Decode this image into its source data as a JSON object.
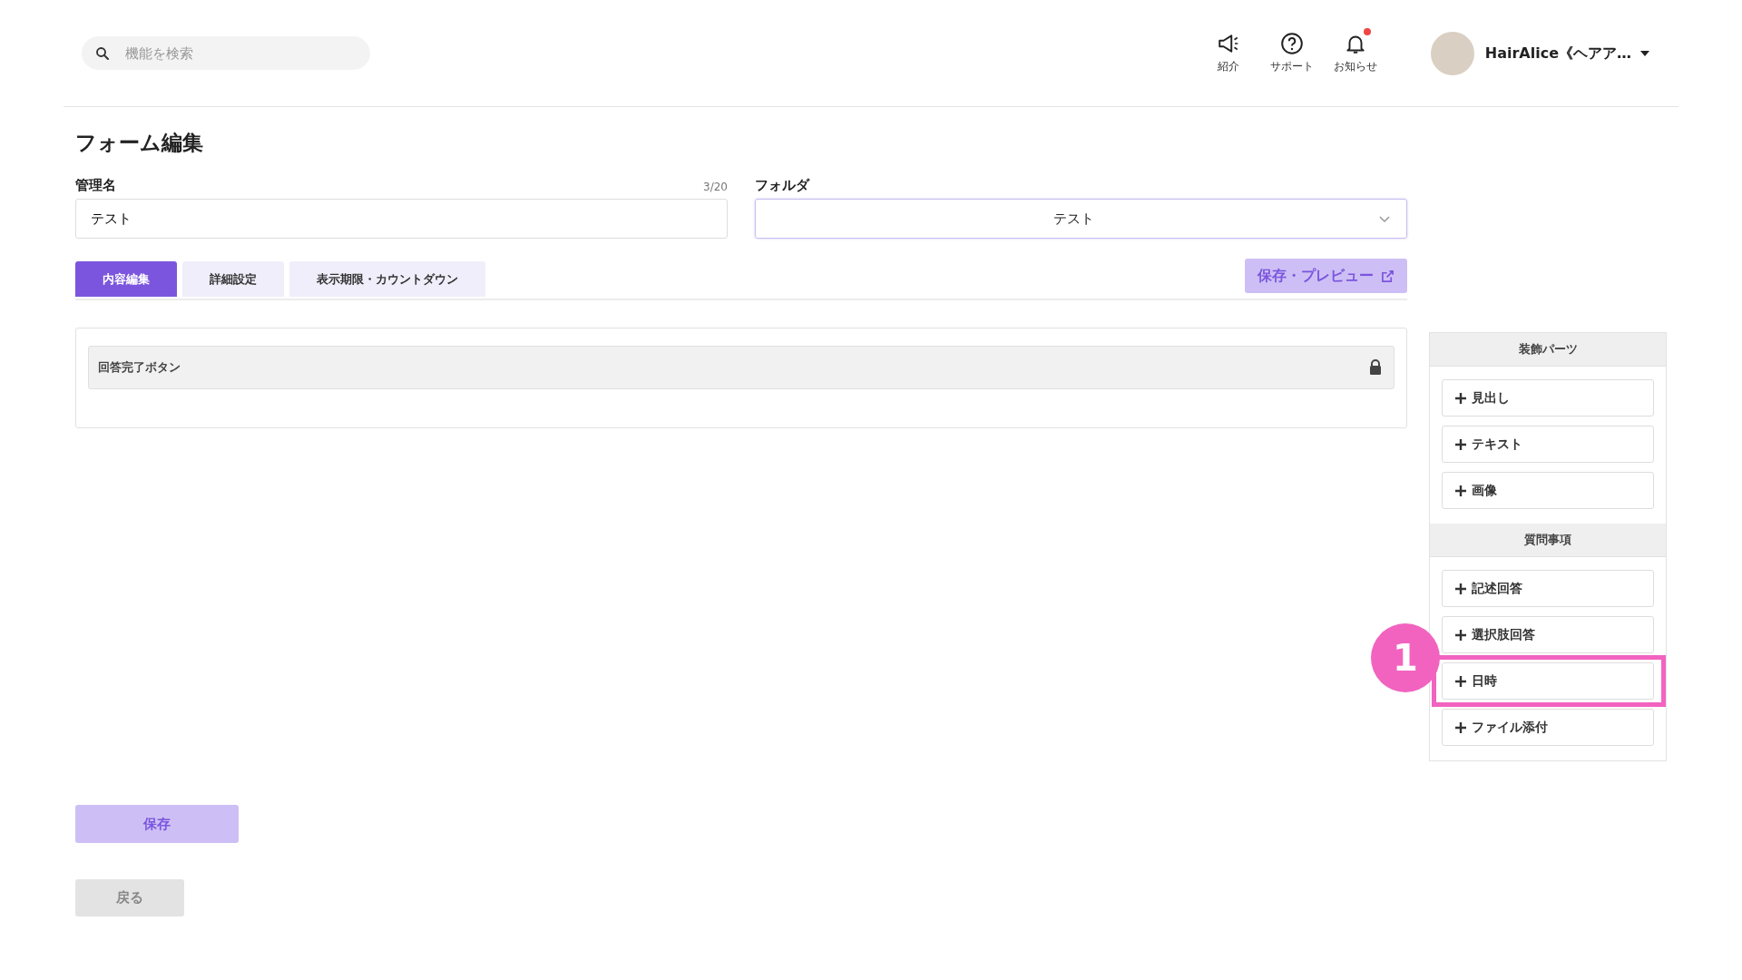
{
  "header": {
    "search": {
      "placeholder": "機能を検索"
    },
    "nav_items": [
      {
        "kind": "megaphone",
        "label": "紹介",
        "unread": false
      },
      {
        "kind": "help",
        "label": "サポート",
        "unread": false
      },
      {
        "kind": "bell",
        "label": "お知らせ",
        "unread": true
      }
    ],
    "user": {
      "name": "HairAlice《ヘアア…"
    }
  },
  "page_title": "フォーム編集",
  "fields": {
    "name": {
      "label": "管理名",
      "counter": "3/20",
      "value": "テスト"
    },
    "folder": {
      "label": "フォルダ",
      "value": "テスト"
    }
  },
  "tabs": [
    {
      "label": "内容編集",
      "selected": true
    },
    {
      "label": "詳細設定",
      "selected": false
    },
    {
      "label": "表示期限・カウントダウン",
      "selected": false
    }
  ],
  "preview_button": "保存・プレビュー",
  "form_items": [
    {
      "label": "回答完了ボタン",
      "locked": true
    }
  ],
  "parts_panel": {
    "sections": [
      {
        "title": "装飾パーツ",
        "items": [
          {
            "label": "見出し",
            "highlighted": false
          },
          {
            "label": "テキスト",
            "highlighted": false
          },
          {
            "label": "画像",
            "highlighted": false
          }
        ]
      },
      {
        "title": "質問事項",
        "items": [
          {
            "label": "記述回答",
            "highlighted": false
          },
          {
            "label": "選択肢回答",
            "highlighted": false
          },
          {
            "label": "日時",
            "highlighted": true,
            "callout": "1"
          },
          {
            "label": "ファイル添付",
            "highlighted": false
          }
        ]
      }
    ]
  },
  "save_button": "保存",
  "back_button": "戻る"
}
